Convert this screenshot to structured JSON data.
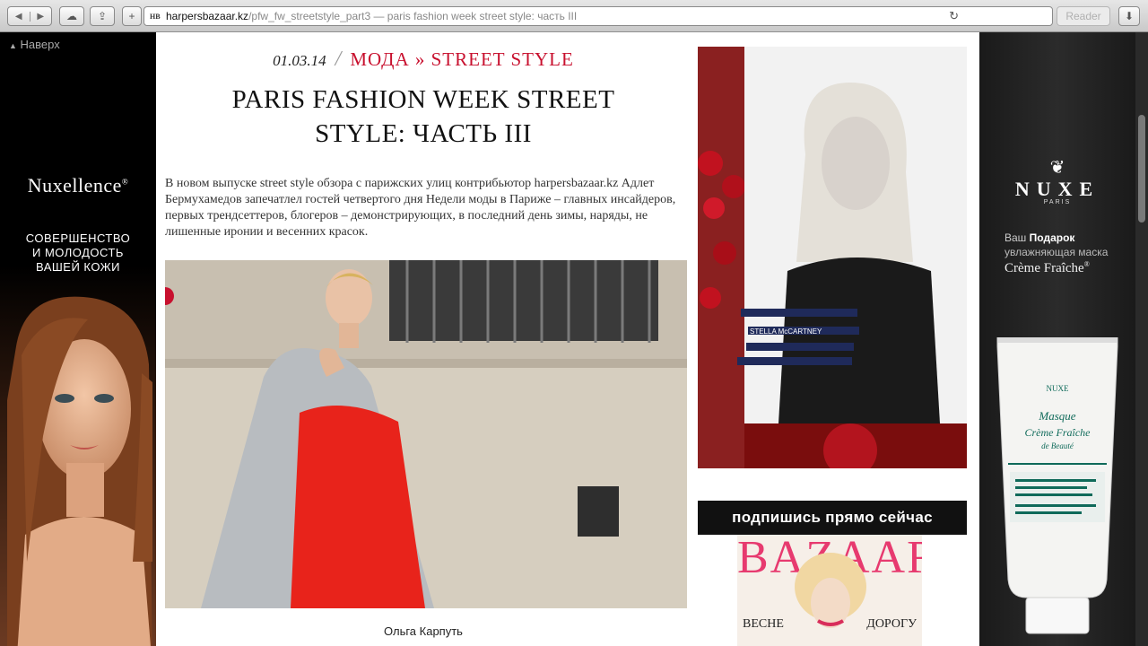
{
  "browser": {
    "favicon": "HB",
    "url_host": "harpersbazaar.kz",
    "url_path": "/pfw_fw_streetstyle_part3 — paris fashion week street style: часть III",
    "reader_label": "Reader",
    "add_label": "+"
  },
  "page": {
    "back_to_top": "Наверх"
  },
  "ad_left": {
    "brand": "Nuxellence",
    "brand_mark": "®",
    "slogan_1": "СОВЕРШЕНСТВО",
    "slogan_2": "И МОЛОДОСТЬ",
    "slogan_3": "ВАШЕЙ КОЖИ"
  },
  "article": {
    "date": "01.03.14",
    "slash": "/",
    "category": "МОДА » STREET STYLE",
    "title_line1": "PARIS FASHION WEEK STREET",
    "title_line2": "STYLE: ЧАСТЬ III",
    "lead": "В новом выпуске street style обзора с парижских улиц контрибьютор harpersbazaar.kz Адлет Бермухамедов запечатлел гостей четвертого дня Недели моды в Париже – главных инсайдеров, первых трендсеттеров, блогеров – демонстрирующих, в последний день зимы, наряды, не лишенные иронии и весенних красок.",
    "caption": "Ольга Карпуть"
  },
  "sidebar": {
    "stella_text": "STELLA McCARTNEY",
    "subscribe": "подпишись прямо сейчас",
    "mag_title": "BAZAAR",
    "mag_word1": "ВЕСНЕ",
    "mag_word2": "ДОРОГУ"
  },
  "ad_right": {
    "logo": "NUXE",
    "paris": "PARIS",
    "offer_prefix": "Ваш",
    "offer_bold": "Подарок",
    "offer_line2": "увлажняющая маска",
    "offer_line3": "Crème Fraîche",
    "offer_mark": "®",
    "tube_brand": "NUXE",
    "tube_name1": "Masque",
    "tube_name2": "Crème Fraîche",
    "tube_name3": "de Beauté"
  },
  "colors": {
    "accent_red": "#c8102e"
  }
}
